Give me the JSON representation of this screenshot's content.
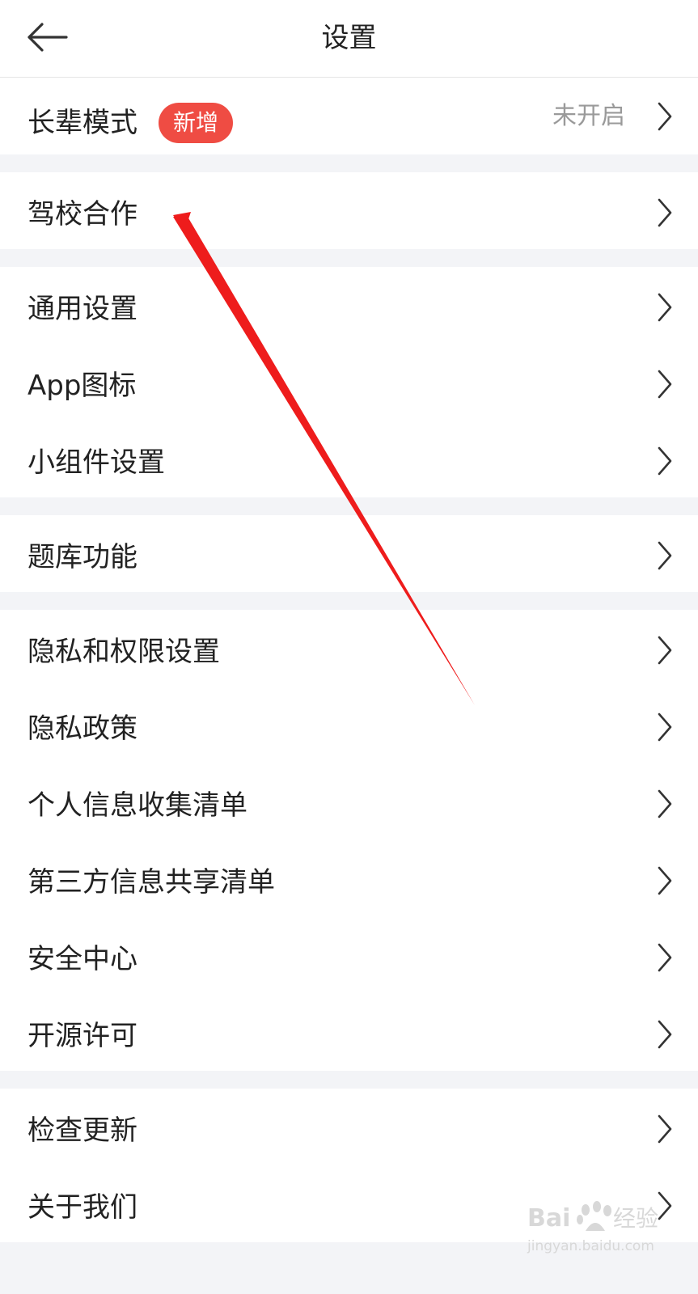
{
  "header": {
    "title": "设置",
    "back_icon": "arrow-left-icon"
  },
  "groups": [
    [
      {
        "label": "长辈模式",
        "badge": "新增",
        "status": "未开启"
      }
    ],
    [
      {
        "label": "驾校合作"
      }
    ],
    [
      {
        "label": "通用设置"
      },
      {
        "label": "App图标"
      },
      {
        "label": "小组件设置"
      }
    ],
    [
      {
        "label": "题库功能"
      }
    ],
    [
      {
        "label": "隐私和权限设置"
      },
      {
        "label": "隐私政策"
      },
      {
        "label": "个人信息收集清单"
      },
      {
        "label": "第三方信息共享清单"
      },
      {
        "label": "安全中心"
      },
      {
        "label": "开源许可"
      }
    ],
    [
      {
        "label": "检查更新"
      },
      {
        "label": "关于我们"
      }
    ]
  ],
  "row_icon": "chevron-right-icon",
  "colors": {
    "badge": "#ef4c43",
    "annotation_arrow": "#ee1c1c",
    "background": "#f3f4f7"
  },
  "watermark": {
    "logo": "Baidu经验",
    "url": "jingyan.baidu.com"
  }
}
